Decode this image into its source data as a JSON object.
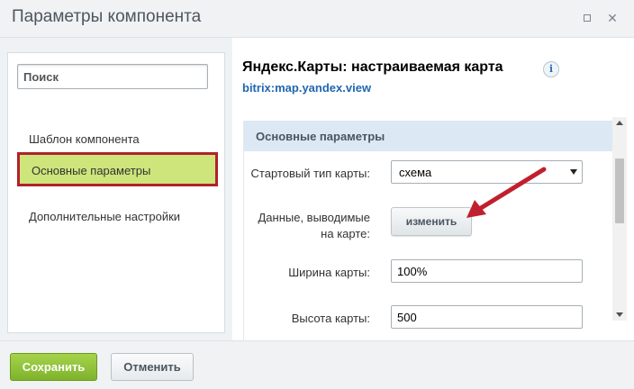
{
  "window": {
    "title": "Параметры компонента"
  },
  "sidebar": {
    "search_placeholder": "Поиск",
    "items": [
      {
        "label": "Шаблон компонента",
        "selected": false
      },
      {
        "label": "Основные параметры",
        "selected": true
      },
      {
        "label": "Дополнительные настройки",
        "selected": false
      }
    ]
  },
  "component": {
    "title": "Яндекс.Карты: настраиваемая карта",
    "code": "bitrix:map.yandex.view",
    "info_icon": "i"
  },
  "params": {
    "section_title": "Основные параметры",
    "map_type": {
      "label": "Стартовый тип карты:",
      "value": "схема"
    },
    "map_data": {
      "label_line1": "Данные, выводимые",
      "label_line2": "на карте:",
      "button": "изменить"
    },
    "width": {
      "label": "Ширина карты:",
      "value": "100%"
    },
    "height": {
      "label": "Высота карты:",
      "value": "500"
    }
  },
  "footer": {
    "save_label": "Сохранить",
    "cancel_label": "Отменить"
  },
  "colors": {
    "highlight_border": "#b0222a",
    "highlight_fill": "#cde57a",
    "save_button": "#8bbf33",
    "link_blue": "#2067b0",
    "annotation_arrow": "#c0202e"
  }
}
